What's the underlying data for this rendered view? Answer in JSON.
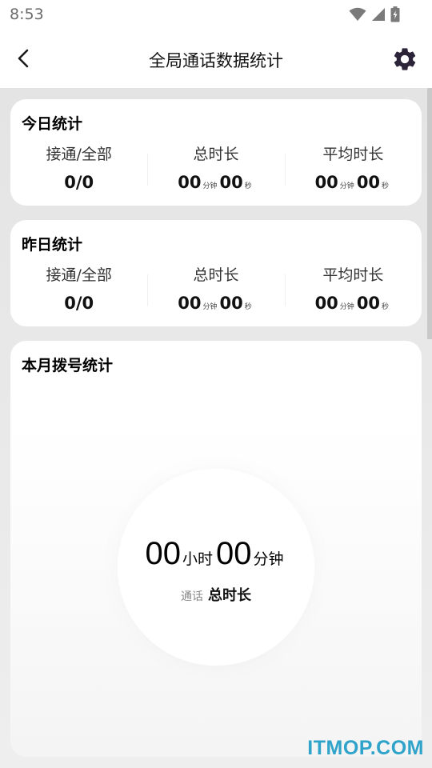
{
  "status_bar": {
    "time": "8:53",
    "icons": [
      "wifi-icon",
      "cell-signal-icon",
      "battery-icon"
    ]
  },
  "header": {
    "title": "全局通话数据统计",
    "back_icon": "back-arrow-icon",
    "settings_icon": "gear-icon"
  },
  "today": {
    "title": "今日统计",
    "stats": [
      {
        "label": "接通/全部",
        "value": "0/0"
      },
      {
        "label": "总时长",
        "min": "00",
        "min_unit": "分钟",
        "sec": "00",
        "sec_unit": "秒"
      },
      {
        "label": "平均时长",
        "min": "00",
        "min_unit": "分钟",
        "sec": "00",
        "sec_unit": "秒"
      }
    ]
  },
  "yesterday": {
    "title": "昨日统计",
    "stats": [
      {
        "label": "接通/全部",
        "value": "0/0"
      },
      {
        "label": "总时长",
        "min": "00",
        "min_unit": "分钟",
        "sec": "00",
        "sec_unit": "秒"
      },
      {
        "label": "平均时长",
        "min": "00",
        "min_unit": "分钟",
        "sec": "00",
        "sec_unit": "秒"
      }
    ]
  },
  "month": {
    "title": "本月拨号统计",
    "hours": "00",
    "hours_unit": "小时",
    "minutes": "00",
    "minutes_unit": "分钟",
    "caption_small": "通话",
    "caption_bold": "总时长"
  },
  "watermark": "ITMOP.COM",
  "colors": {
    "background": "#e9e9e9",
    "card": "#ffffff",
    "icon": "#2b2438",
    "watermark": "#2fa3c9"
  }
}
